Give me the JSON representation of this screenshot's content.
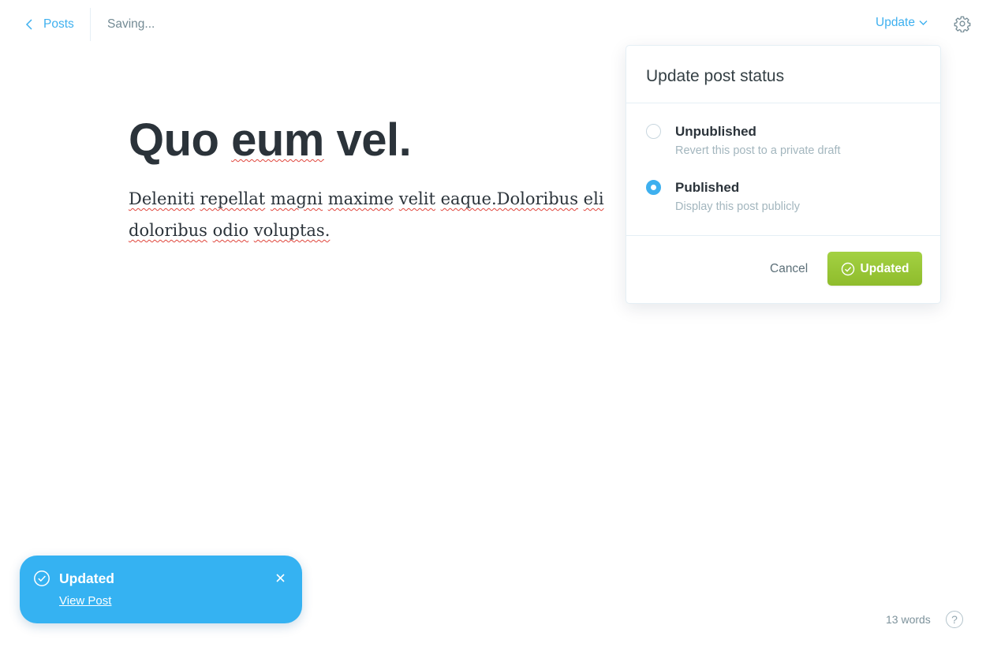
{
  "header": {
    "back_label": "Posts",
    "status_text": "Saving...",
    "update_menu_label": "Update"
  },
  "editor": {
    "title_words": [
      "Quo",
      "eum",
      "vel."
    ],
    "body_words": [
      "Deleniti",
      "repellat",
      "magni",
      "maxime",
      "velit",
      "eaque.Doloribus",
      "eli",
      "doloribus",
      "odio",
      "voluptas."
    ]
  },
  "publish_menu": {
    "title": "Update post status",
    "options": [
      {
        "label": "Unpublished",
        "description": "Revert this post to a private draft",
        "selected": false
      },
      {
        "label": "Published",
        "description": "Display this post publicly",
        "selected": true
      }
    ],
    "cancel_label": "Cancel",
    "confirm_label": "Updated"
  },
  "notification": {
    "title": "Updated",
    "link_label": "View Post"
  },
  "footer": {
    "word_count": "13 words",
    "help_label": "?"
  },
  "icons": {
    "back": "chevron-left-icon",
    "update_menu": "chevron-down-icon",
    "settings": "gear-icon",
    "confirm": "check-circle-icon",
    "toast": "check-circle-icon",
    "toast_close": "close-icon"
  },
  "colors": {
    "accent": "#3eb0ef",
    "success": "#9fcc3b",
    "toast_background": "#35b2f2",
    "spell_error": "#e0463d"
  }
}
